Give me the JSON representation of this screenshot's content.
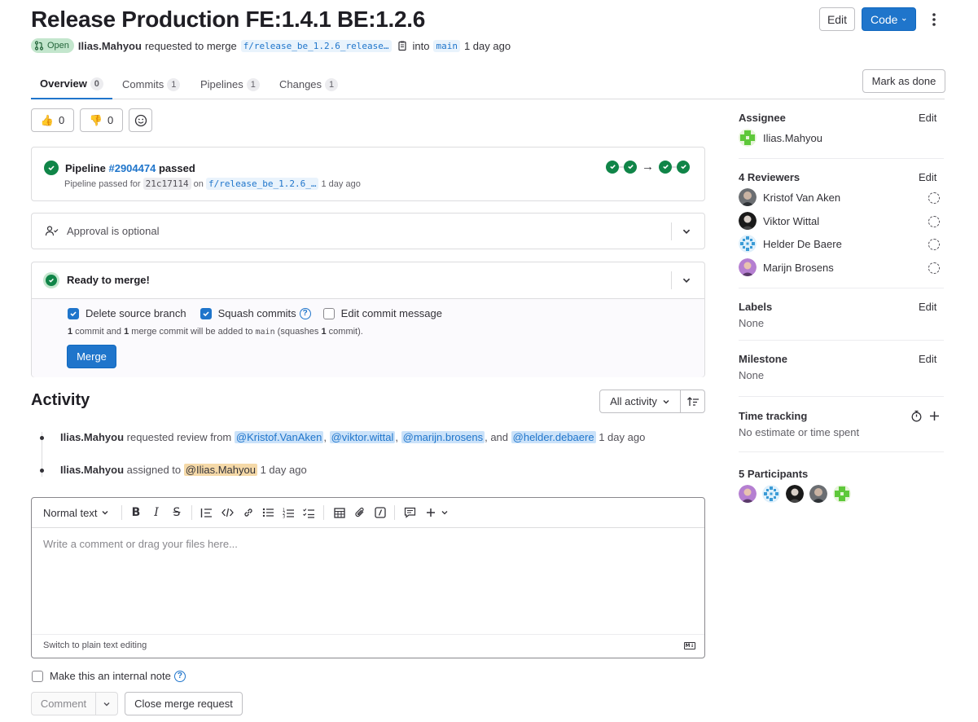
{
  "header": {
    "title": "Release Production FE:1.4.1 BE:1.2.6",
    "status": "Open",
    "author": "Ilias.Mahyou",
    "requested_text": "requested to merge",
    "source_branch": "f/release_be_1.2.6_release…",
    "into_text": "into",
    "target_branch": "main",
    "time": "1 day ago",
    "edit_label": "Edit",
    "code_label": "Code"
  },
  "tabs": [
    {
      "label": "Overview",
      "count": "0"
    },
    {
      "label": "Commits",
      "count": "1"
    },
    {
      "label": "Pipelines",
      "count": "1"
    },
    {
      "label": "Changes",
      "count": "1"
    }
  ],
  "mark_done_label": "Mark as done",
  "reactions": {
    "thumbs_up": "0",
    "thumbs_down": "0"
  },
  "pipeline": {
    "prefix": "Pipeline",
    "id": "#2904474",
    "status": "passed",
    "sub_prefix": "Pipeline passed for",
    "commit": "21c17114",
    "on_text": "on",
    "branch": "f/release_be_1.2.6_…",
    "time": "1 day ago"
  },
  "approval": {
    "label": "Approval is optional"
  },
  "merge": {
    "title": "Ready to merge!",
    "delete_source": "Delete source branch",
    "squash": "Squash commits",
    "edit_message": "Edit commit message",
    "summary_1": "1",
    "summary_2": " commit and ",
    "summary_3": "1",
    "summary_4": " merge commit will be added to ",
    "summary_5": "main",
    "summary_6": " (squashes ",
    "summary_7": "1",
    "summary_8": " commit).",
    "button": "Merge"
  },
  "activity": {
    "title": "Activity",
    "filter": "All activity",
    "items": [
      {
        "author": "Ilias.Mahyou",
        "text": "requested review from",
        "m1": "@Kristof.VanAken",
        "m2": "@viktor.wittal",
        "m3": "@marijn.brosens",
        "and_text": ", and",
        "m4": "@helder.debaere",
        "time": "1 day ago"
      },
      {
        "author": "Ilias.Mahyou",
        "text": "assigned to",
        "m1": "@Ilias.Mahyou",
        "time": "1 day ago"
      }
    ]
  },
  "editor": {
    "format": "Normal text",
    "placeholder": "Write a comment or drag your files here...",
    "switch": "Switch to plain text editing",
    "internal_note": "Make this an internal note",
    "comment_btn": "Comment",
    "close_btn": "Close merge request"
  },
  "sidebar": {
    "assignee_title": "Assignee",
    "assignee_name": "Ilias.Mahyou",
    "reviewers_title": "4 Reviewers",
    "reviewers": [
      "Kristof Van Aken",
      "Viktor Wittal",
      "Helder De Baere",
      "Marijn Brosens"
    ],
    "labels_title": "Labels",
    "labels_value": "None",
    "milestone_title": "Milestone",
    "milestone_value": "None",
    "time_title": "Time tracking",
    "time_value": "No estimate or time spent",
    "participants_title": "5 Participants",
    "edit": "Edit"
  },
  "colors": {
    "accent": "#1f75cb",
    "success": "#108548",
    "open_badge": "#c3e6cd"
  }
}
